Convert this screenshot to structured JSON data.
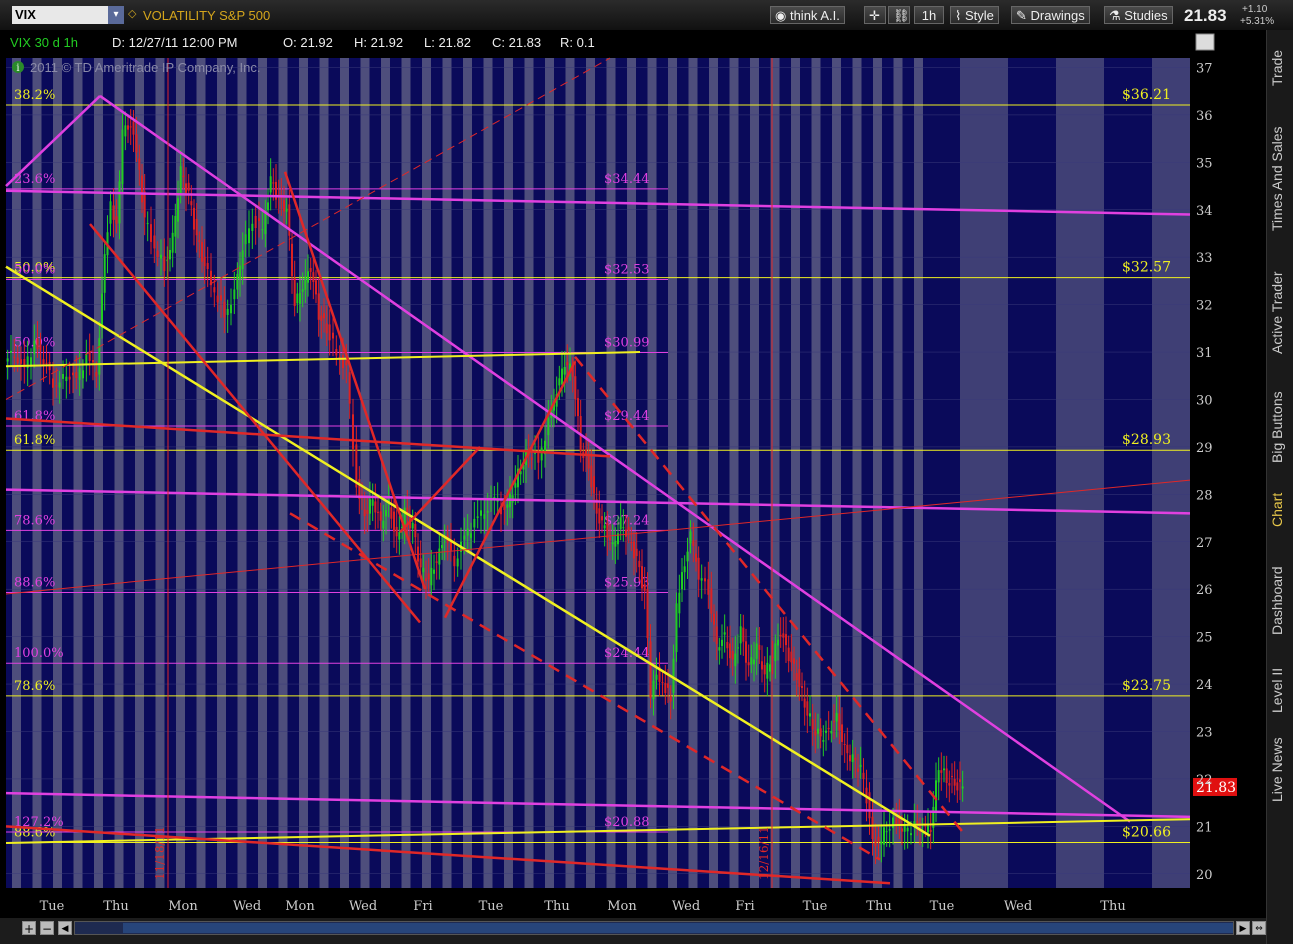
{
  "toolbar": {
    "symbol": "VIX",
    "description": "VOLATILITY S&P 500",
    "think_label": "think A.I.",
    "timeframe": "1h",
    "style_label": "Style",
    "drawings_label": "Drawings",
    "studies_label": "Studies",
    "last_price": "21.83",
    "net_change": "+1.10",
    "pct_change": "+5.31%"
  },
  "sidebar": {
    "tabs": [
      "Trade",
      "Times And Sales",
      "Active Trader",
      "Big Buttons",
      "Chart",
      "Dashboard",
      "Level II",
      "Live News"
    ]
  },
  "header": {
    "study_label": "VIX 30 d 1h",
    "date": "D: 12/27/11 12:00 PM",
    "open": "O: 21.92",
    "high": "H: 21.92",
    "low": "L: 21.82",
    "close": "C: 21.83",
    "range": "R: 0.1",
    "copyright": "2011 © TD Ameritrade IP Company, Inc."
  },
  "colors": {
    "plot_bg": "#0a0a5a",
    "bar_shade": "#5a5a82",
    "future_bg": "#3f3f75",
    "magenta": "#e040e0",
    "yellow": "#f0f020",
    "red": "#e02828",
    "candle_green": "#22cc22",
    "candle_red": "#dd2222"
  },
  "chart_data": {
    "type": "candlestick",
    "symbol": "VIX",
    "ylim": [
      19.7,
      37.2
    ],
    "y_ticks": [
      20,
      21,
      22,
      23,
      24,
      25,
      26,
      27,
      28,
      29,
      30,
      31,
      32,
      33,
      34,
      35,
      36,
      37
    ],
    "x_day_labels": [
      "Tue",
      "Thu",
      "Mon",
      "Wed",
      "Mon",
      "Wed",
      "Fri",
      "Tue",
      "Thu",
      "Mon",
      "Wed",
      "Fri",
      "Tue",
      "Thu",
      "Tue",
      "Wed",
      "Thu"
    ],
    "vertical_date_labels": [
      "11/18/11",
      "12/16/11"
    ],
    "current_price": 21.83,
    "close_path": [
      [
        0,
        30.8
      ],
      [
        10,
        31.0
      ],
      [
        20,
        30.6
      ],
      [
        30,
        31.2
      ],
      [
        42,
        30.7
      ],
      [
        52,
        30.2
      ],
      [
        62,
        30.6
      ],
      [
        72,
        30.4
      ],
      [
        82,
        30.9
      ],
      [
        92,
        30.6
      ],
      [
        100,
        33.0
      ],
      [
        106,
        34.2
      ],
      [
        112,
        33.6
      ],
      [
        118,
        35.6
      ],
      [
        126,
        35.8
      ],
      [
        132,
        35.2
      ],
      [
        140,
        33.8
      ],
      [
        150,
        33.2
      ],
      [
        160,
        32.8
      ],
      [
        168,
        33.4
      ],
      [
        176,
        34.8
      ],
      [
        184,
        34.3
      ],
      [
        192,
        33.4
      ],
      [
        200,
        32.8
      ],
      [
        210,
        32.3
      ],
      [
        220,
        31.8
      ],
      [
        230,
        32.2
      ],
      [
        238,
        33.2
      ],
      [
        248,
        33.8
      ],
      [
        258,
        33.6
      ],
      [
        266,
        34.6
      ],
      [
        274,
        34.2
      ],
      [
        282,
        34.0
      ],
      [
        290,
        32.0
      ],
      [
        298,
        32.4
      ],
      [
        306,
        32.8
      ],
      [
        314,
        31.8
      ],
      [
        322,
        31.5
      ],
      [
        332,
        31.0
      ],
      [
        342,
        30.6
      ],
      [
        352,
        28.2
      ],
      [
        360,
        27.6
      ],
      [
        368,
        27.9
      ],
      [
        376,
        27.4
      ],
      [
        384,
        27.8
      ],
      [
        392,
        27.0
      ],
      [
        400,
        27.6
      ],
      [
        408,
        27.3
      ],
      [
        416,
        26.4
      ],
      [
        424,
        26.2
      ],
      [
        432,
        26.6
      ],
      [
        440,
        27.1
      ],
      [
        450,
        26.6
      ],
      [
        460,
        27.1
      ],
      [
        470,
        27.4
      ],
      [
        480,
        27.7
      ],
      [
        490,
        27.9
      ],
      [
        500,
        27.6
      ],
      [
        508,
        28.1
      ],
      [
        516,
        28.6
      ],
      [
        524,
        28.9
      ],
      [
        534,
        28.7
      ],
      [
        544,
        29.5
      ],
      [
        552,
        30.2
      ],
      [
        560,
        30.8
      ],
      [
        568,
        30.6
      ],
      [
        576,
        29.0
      ],
      [
        584,
        28.6
      ],
      [
        592,
        27.6
      ],
      [
        600,
        27.3
      ],
      [
        608,
        26.9
      ],
      [
        616,
        27.4
      ],
      [
        624,
        27.1
      ],
      [
        632,
        26.6
      ],
      [
        640,
        25.9
      ],
      [
        646,
        23.8
      ],
      [
        652,
        24.3
      ],
      [
        658,
        24.0
      ],
      [
        666,
        23.7
      ],
      [
        672,
        25.6
      ],
      [
        680,
        26.6
      ],
      [
        686,
        27.1
      ],
      [
        694,
        26.3
      ],
      [
        704,
        26.0
      ],
      [
        712,
        24.8
      ],
      [
        720,
        25.0
      ],
      [
        728,
        24.4
      ],
      [
        736,
        25.1
      ],
      [
        744,
        24.3
      ],
      [
        752,
        24.8
      ],
      [
        760,
        24.2
      ],
      [
        768,
        24.6
      ],
      [
        776,
        25.1
      ],
      [
        784,
        24.6
      ],
      [
        792,
        24.2
      ],
      [
        800,
        23.6
      ],
      [
        808,
        23.1
      ],
      [
        816,
        22.9
      ],
      [
        824,
        23.0
      ],
      [
        832,
        23.3
      ],
      [
        840,
        22.6
      ],
      [
        848,
        22.4
      ],
      [
        856,
        22.2
      ],
      [
        862,
        21.6
      ],
      [
        868,
        20.8
      ],
      [
        874,
        20.6
      ],
      [
        882,
        21.0
      ],
      [
        892,
        21.1
      ],
      [
        900,
        20.9
      ],
      [
        910,
        21.0
      ],
      [
        918,
        20.95
      ],
      [
        926,
        21.0
      ],
      [
        934,
        22.3
      ],
      [
        942,
        22.0
      ],
      [
        950,
        21.9
      ],
      [
        958,
        21.83
      ]
    ],
    "fibonacci_magenta": [
      {
        "label": "23.6%",
        "price": 34.44,
        "price_label": "$34.44"
      },
      {
        "label": "50.0%",
        "price": 32.53,
        "price_label": "$32.53"
      },
      {
        "label": "50.0%",
        "price": 30.99,
        "price_label": "$30.99"
      },
      {
        "label": "61.8%",
        "price": 29.44,
        "price_label": "$29.44"
      },
      {
        "label": "78.6%",
        "price": 27.24,
        "price_label": "$27.24"
      },
      {
        "label": "88.6%",
        "price": 25.93,
        "price_label": "$25.93"
      },
      {
        "label": "100.0%",
        "price": 24.44,
        "price_label": "$24.44"
      },
      {
        "label": "127.2%",
        "price": 20.88,
        "price_label": "$20.88"
      }
    ],
    "fibonacci_yellow": [
      {
        "label": "38.2%",
        "price": 36.21,
        "price_label": "$36.21"
      },
      {
        "label": "50.0%",
        "price": 32.57,
        "price_label": "$32.57"
      },
      {
        "label": "61.8%",
        "price": 28.93,
        "price_label": "$28.93"
      },
      {
        "label": "78.6%",
        "price": 23.75,
        "price_label": "$23.75"
      },
      {
        "label": "88.6%",
        "price": 20.66,
        "price_label": "$20.66"
      }
    ]
  }
}
